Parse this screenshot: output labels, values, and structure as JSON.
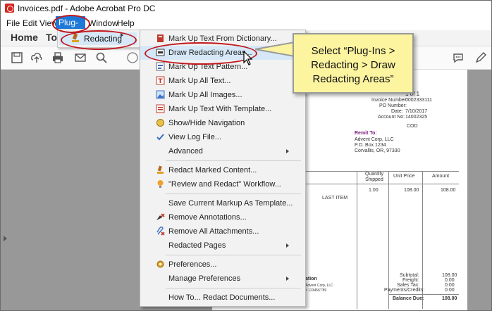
{
  "window": {
    "title": "Invoices.pdf - Adobe Acrobat Pro DC"
  },
  "menubar": {
    "items": [
      "File",
      "Edit",
      "View",
      "Plug-Ins",
      "Window",
      "Help"
    ]
  },
  "tabs": {
    "home": "Home",
    "tools": "To"
  },
  "submenu": {
    "label": "Redacting"
  },
  "dropdown": {
    "items": [
      {
        "label": "Mark Up Text From Dictionary...",
        "icon": "dictionary-icon"
      },
      {
        "label": "Draw Redacting Areas...",
        "icon": "draw-redact-icon"
      },
      {
        "label": "Mark Up Text Pattern...",
        "icon": "pattern-icon"
      },
      {
        "label": "Mark Up All Text...",
        "icon": "text-icon"
      },
      {
        "label": "Mark Up All Images...",
        "icon": "image-icon"
      },
      {
        "label": "Mark Up Text With Template...",
        "icon": "template-icon"
      },
      {
        "label": "Show/Hide Navigation",
        "icon": "navigation-icon"
      },
      {
        "label": "View Log File...",
        "icon": "log-icon"
      },
      {
        "label": "Advanced"
      },
      {
        "label": "Redact Marked Content...",
        "icon": "redact-icon"
      },
      {
        "label": "\"Review and Redact\" Workflow...",
        "icon": "bulb-icon"
      },
      {
        "label": "Save Current Markup As Template..."
      },
      {
        "label": "Remove Annotations...",
        "icon": "remove-annotations-icon"
      },
      {
        "label": "Remove All Attachments...",
        "icon": "remove-attachments-icon"
      },
      {
        "label": "Redacted Pages"
      },
      {
        "label": "Preferences...",
        "icon": "preferences-icon"
      },
      {
        "label": "Manage Preferences"
      },
      {
        "label": "How To... Redact Documents..."
      }
    ]
  },
  "callout": {
    "text": "Select “Plug-Ins > Redacting > Draw Redacting Areas”"
  },
  "invoice": {
    "page": "1 of 1",
    "invoice_number_label": "Invoice Number:",
    "invoice_number": "0002333111",
    "po_label": "PO Number:",
    "date_label": "Date:",
    "date": "7/10/2017",
    "account_label": "Account No:",
    "account": "14002325",
    "terms": "COD",
    "remit_label": "Remit To:",
    "remit_name": "Advent Corp, LLC",
    "remit_box": "P.O. Box 1234",
    "remit_city": "Corvallis, OR, 97330",
    "col_qty": "Quantity Shipped",
    "col_unit": "Unit Price",
    "col_amount": "Amount",
    "qty": "1.00",
    "unit": "108.00",
    "amount": "108.00",
    "item": "LAST ITEM",
    "subtotal_label": "Subtotal:",
    "subtotal": "108.00",
    "freight_label": "Freight:",
    "freight": "0.00",
    "tax_label": "Sales Tax:",
    "tax": "0.00",
    "payments_label": "Payments/Credits:",
    "payments": "0.00",
    "balance_label": "Balance Due:",
    "balance": "108.00",
    "footer_word": "ation",
    "footer_company": "Advent Corp, LLC",
    "footer_acct": "# 1234567'89"
  },
  "colors": {
    "accent": "#1e78d7",
    "highlight": "#c0181f",
    "callout": "#fdf4a0"
  }
}
